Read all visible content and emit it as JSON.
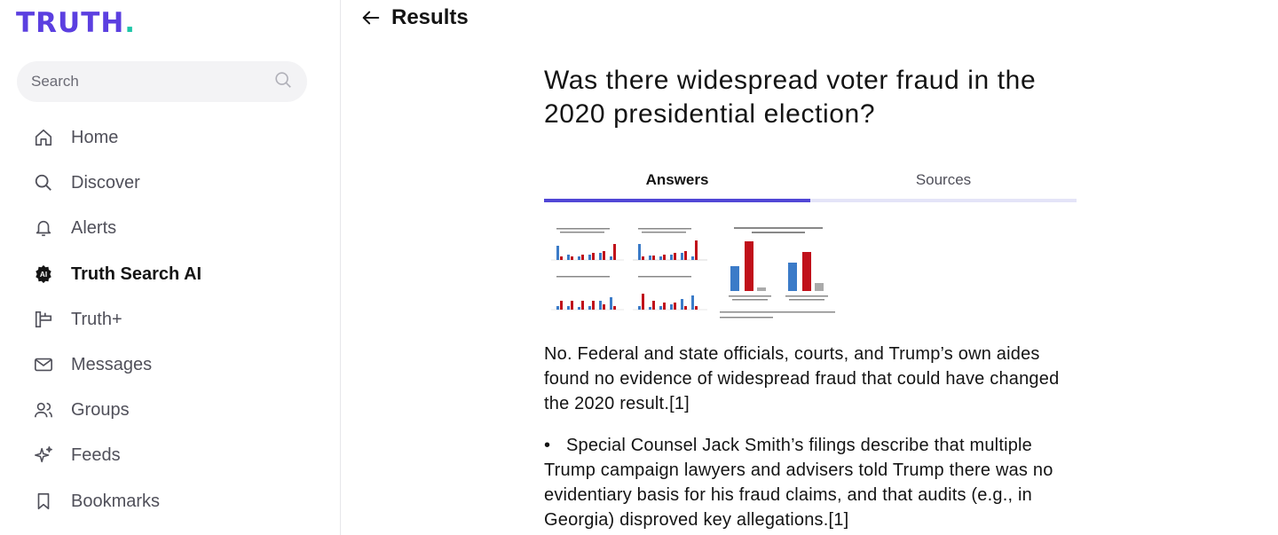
{
  "logo": {
    "text": "TRUTH",
    "dot": "."
  },
  "search": {
    "placeholder": "Search"
  },
  "nav": [
    {
      "label": "Home",
      "icon": "home-icon"
    },
    {
      "label": "Discover",
      "icon": "search-icon"
    },
    {
      "label": "Alerts",
      "icon": "bell-icon"
    },
    {
      "label": "Truth Search AI",
      "icon": "ai-icon",
      "active": true
    },
    {
      "label": "Truth+",
      "icon": "truth-plus-icon"
    },
    {
      "label": "Messages",
      "icon": "mail-icon"
    },
    {
      "label": "Groups",
      "icon": "users-icon"
    },
    {
      "label": "Feeds",
      "icon": "sparkle-icon"
    },
    {
      "label": "Bookmarks",
      "icon": "bookmark-icon"
    }
  ],
  "header": {
    "title": "Results"
  },
  "question": "Was there widespread voter fraud in the 2020 presidential election?",
  "tabs": {
    "answers": "Answers",
    "sources": "Sources"
  },
  "answer": "No. Federal and state officials, courts, and Trump’s own aides found no evidence of widespread fraud that could have changed the 2020 result.[1]",
  "bullets": [
    "Special Counsel Jack Smith’s filings describe that multiple Trump campaign lawyers and advisers told Trump there was no evidentiary basis for his fraud claims, and that audits (e.g., in Georgia) disproved key allegations.[1]"
  ],
  "colors": {
    "brand": "#5b3fe0",
    "brand_dot": "#1ec6a8",
    "tab_active": "#5147d6",
    "tab_inactive": "#e4e4f8",
    "bar_red": "#c0101a",
    "bar_blue": "#3b7bc8"
  }
}
